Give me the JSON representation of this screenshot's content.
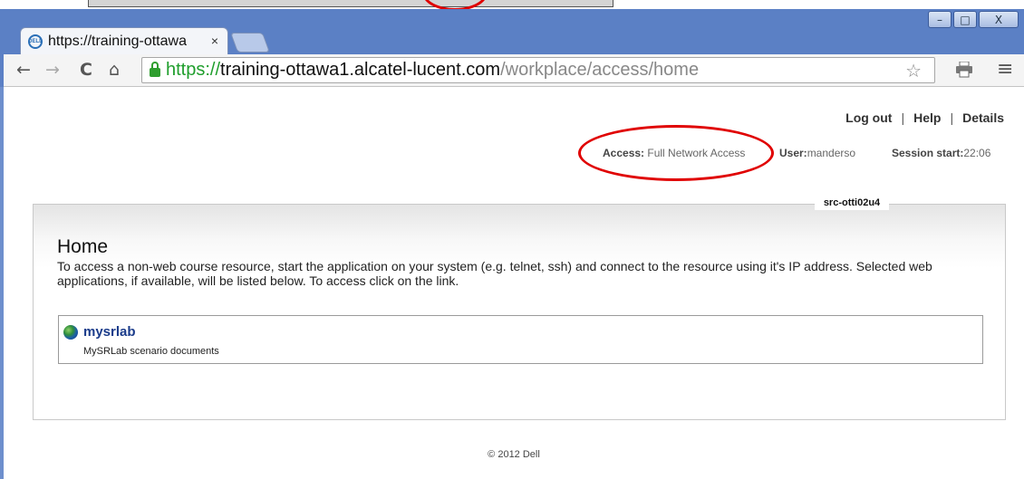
{
  "browser": {
    "tab_title": "https://training-ottawa",
    "tab_close": "×",
    "favicon_label": "DELL",
    "window_controls": {
      "minimize": "–",
      "maximize": "□",
      "close": "X"
    },
    "nav": {
      "back": "←",
      "forward": "→",
      "reload": "C",
      "home": "⌂"
    },
    "url": {
      "scheme": "https://",
      "host": "training-ottawa1.alcatel-lucent.com",
      "path": "/workplace/access/home"
    },
    "star": "☆",
    "menu": "≡"
  },
  "header": {
    "links": [
      "Log out",
      "Help",
      "Details"
    ],
    "separator": "|",
    "access_label": "Access:",
    "access_value": "Full Network Access",
    "user_label": "User:",
    "user_value": "manderso",
    "session_label": "Session start:",
    "session_value": "22:06",
    "server_name": "src-otti02u4"
  },
  "main": {
    "title": "Home",
    "description": "To access a non-web course resource, start the application on your system (e.g. telnet, ssh) and connect to the resource using it's IP address. Selected web applications, if available, will be listed below. To access click on the link.",
    "apps": [
      {
        "name": "mysrlab",
        "description": "MySRLab scenario documents"
      }
    ]
  },
  "footer": {
    "copyright": "© 2012 Dell"
  },
  "colors": {
    "annotation_red": "#e00000",
    "link_blue": "#1a3b8a",
    "secure_green": "#1f9e2c"
  }
}
